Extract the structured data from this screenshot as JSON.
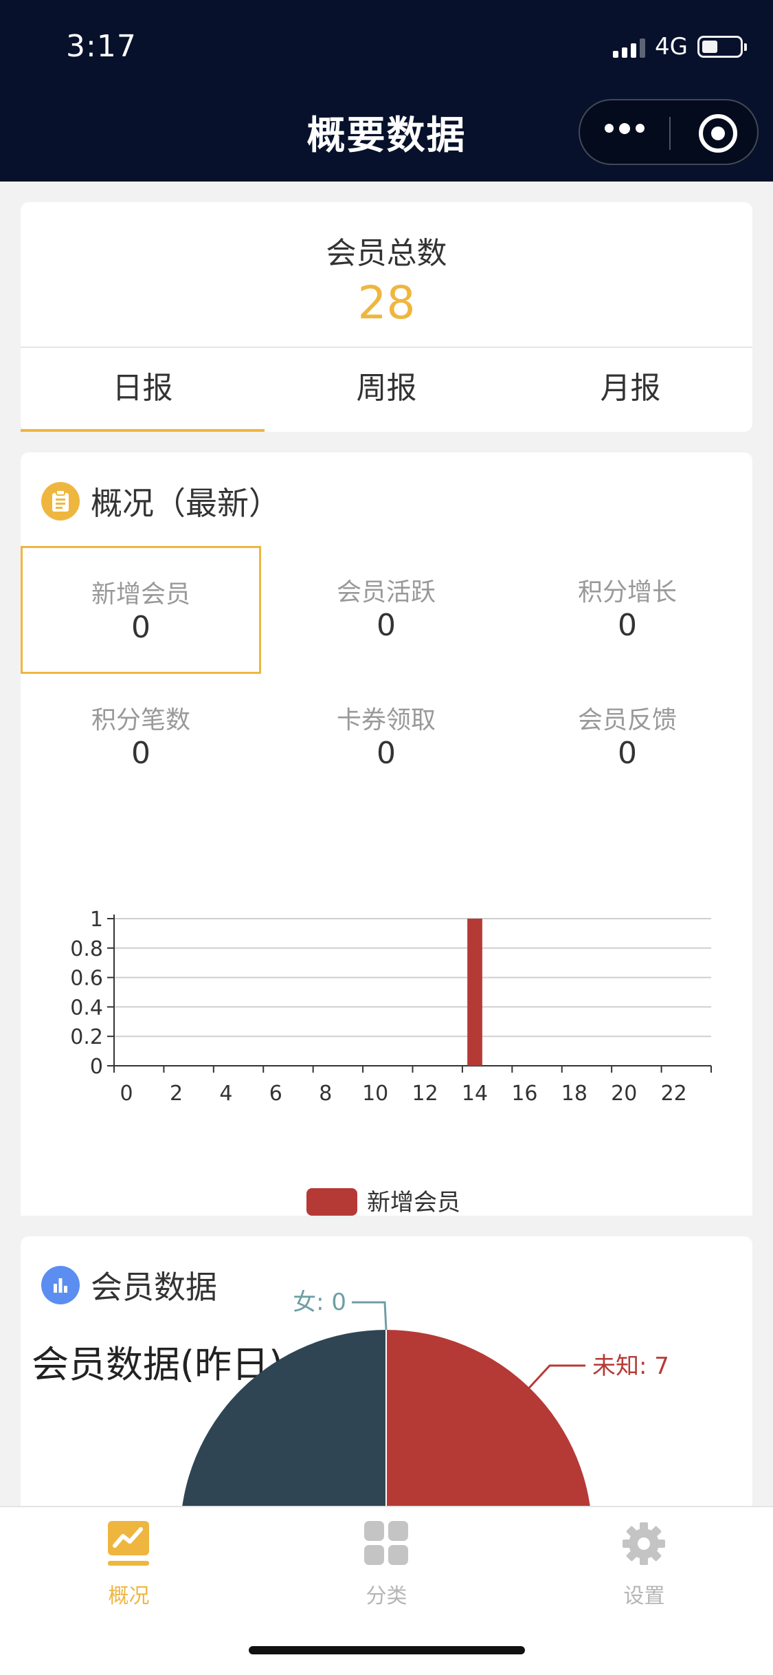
{
  "status_bar": {
    "time": "3:17",
    "network": "4G"
  },
  "nav": {
    "title": "概要数据"
  },
  "summary": {
    "label": "会员总数",
    "value": "28",
    "tabs": [
      {
        "label": "日报"
      },
      {
        "label": "周报"
      },
      {
        "label": "月报"
      }
    ],
    "active_tab": 0
  },
  "overview": {
    "title": "概况（最新）",
    "metrics": [
      {
        "label": "新增会员",
        "value": "0"
      },
      {
        "label": "会员活跃",
        "value": "0"
      },
      {
        "label": "积分增长",
        "value": "0"
      },
      {
        "label": "积分笔数",
        "value": "0"
      },
      {
        "label": "卡券领取",
        "value": "0"
      },
      {
        "label": "会员反馈",
        "value": "0"
      }
    ],
    "selected_metric": 0
  },
  "chart_data": {
    "type": "bar",
    "x": [
      0,
      1,
      2,
      3,
      4,
      5,
      6,
      7,
      8,
      9,
      10,
      11,
      12,
      13,
      14,
      15,
      16,
      17,
      18,
      19,
      20,
      21,
      22,
      23
    ],
    "x_tick_labels": [
      "0",
      "2",
      "4",
      "6",
      "8",
      "10",
      "12",
      "14",
      "16",
      "18",
      "20",
      "22"
    ],
    "y_tick_labels": [
      "0",
      "0.2",
      "0.4",
      "0.6",
      "0.8",
      "1"
    ],
    "ylim": [
      0,
      1
    ],
    "series": [
      {
        "name": "新增会员",
        "color": "#b53a36",
        "values": [
          0,
          0,
          0,
          0,
          0,
          0,
          0,
          0,
          0,
          0,
          0,
          0,
          0,
          0,
          1,
          0,
          0,
          0,
          0,
          0,
          0,
          0,
          0,
          0
        ]
      }
    ],
    "legend": "bottom",
    "grid": true
  },
  "member_data": {
    "title": "会员数据",
    "pie_chart": {
      "type": "pie",
      "title": "会员数据(昨日)",
      "slices": [
        {
          "label": "女: 0",
          "value": 0,
          "color": "#6e9ea5"
        },
        {
          "label": "未知: 7",
          "value": 7,
          "color": "#b53a36"
        },
        {
          "label": "",
          "color": "#2f4554"
        }
      ]
    }
  },
  "tabbar": {
    "items": [
      {
        "label": "概况",
        "icon": "chart-line-icon",
        "active": true
      },
      {
        "label": "分类",
        "icon": "grid-icon",
        "active": false
      },
      {
        "label": "设置",
        "icon": "gear-icon",
        "active": false
      }
    ],
    "active_color": "#efb63f",
    "inactive_color": "#b5b5b5"
  }
}
